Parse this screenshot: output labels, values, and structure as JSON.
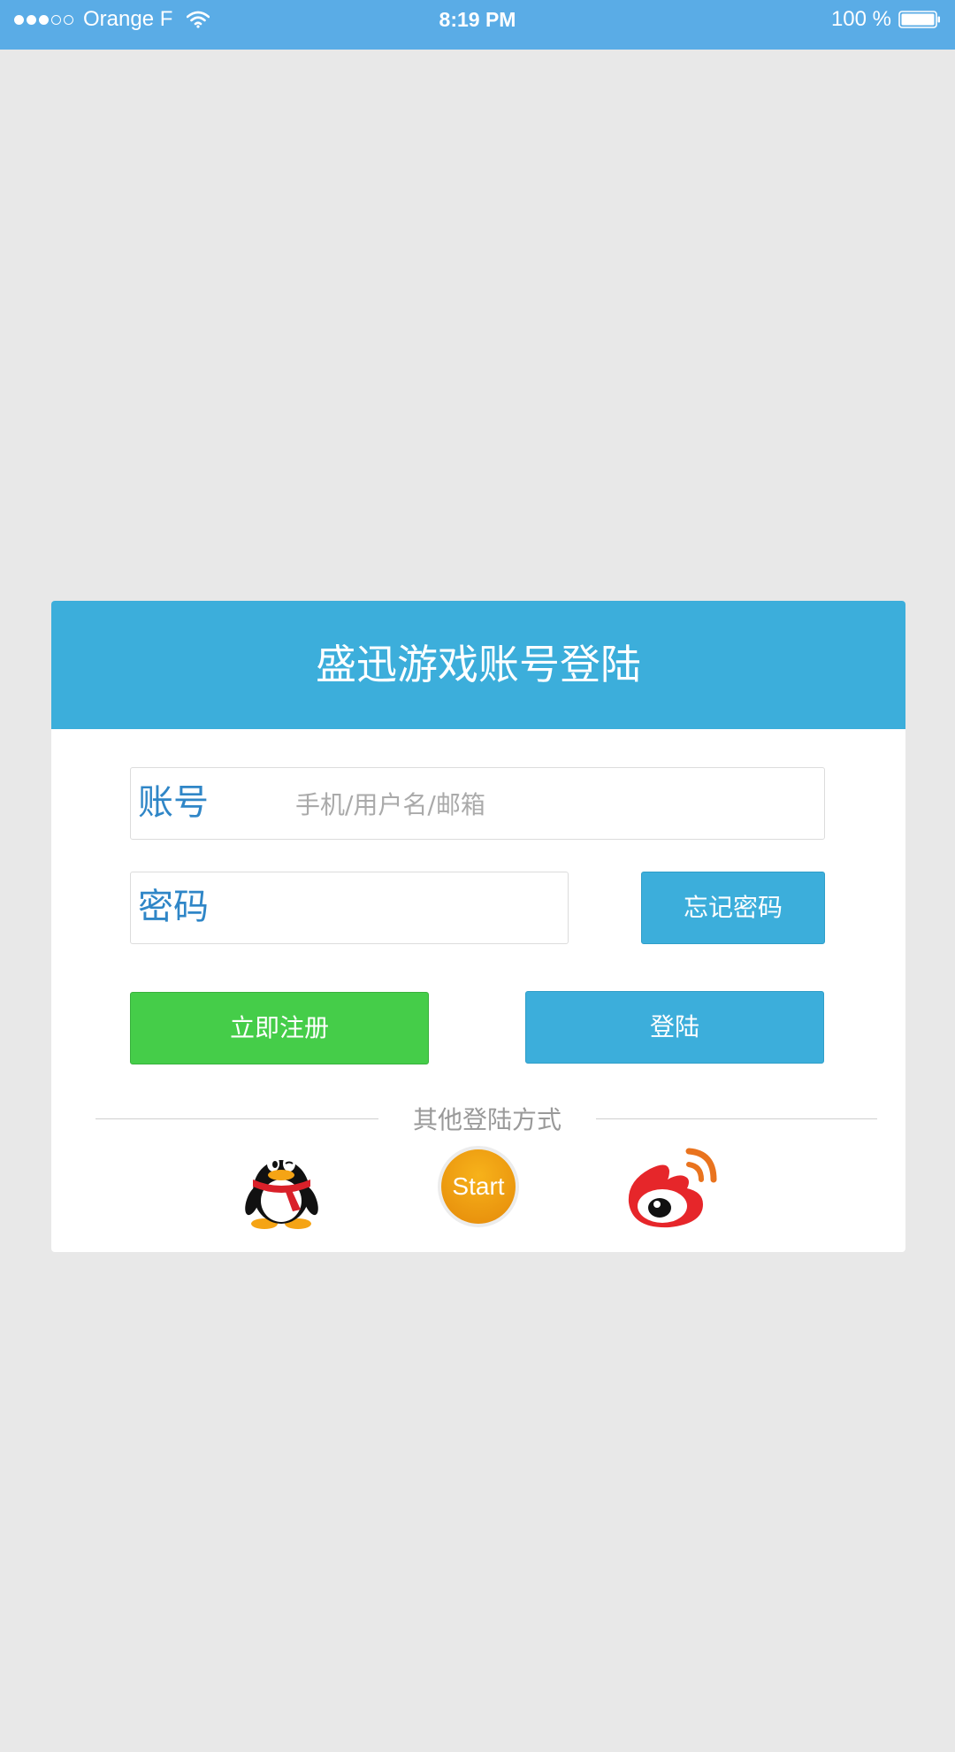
{
  "status_bar": {
    "carrier": "Orange F",
    "time": "8:19 PM",
    "battery": "100 %"
  },
  "login": {
    "title": "盛迅游戏账号登陆",
    "account_label": "账号",
    "account_placeholder": "手机/用户名/邮箱",
    "password_label": "密码",
    "forgot_password_label": "忘记密码",
    "register_label": "立即注册",
    "login_label": "登陆",
    "other_methods_label": "其他登陆方式",
    "social": {
      "start_label": "Start"
    }
  },
  "colors": {
    "status_bar": "#5aace6",
    "header": "#3caedb",
    "register": "#45cd49",
    "label": "#2f86c7"
  },
  "icons": [
    "signal-icon",
    "wifi-icon",
    "battery-icon",
    "qq-icon",
    "start-icon",
    "weibo-icon"
  ]
}
